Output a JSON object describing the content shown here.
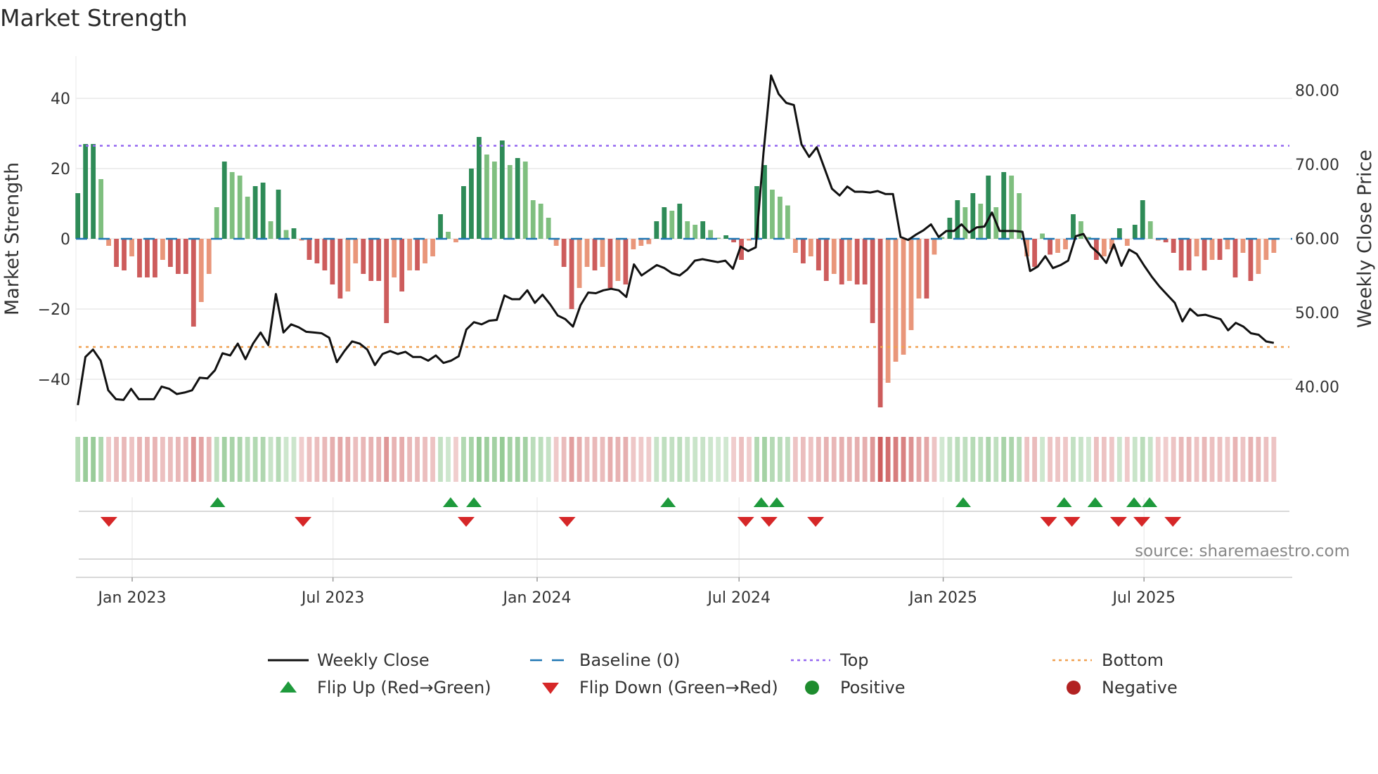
{
  "title": "Market Strength",
  "source": "source: sharemaestro.com",
  "colors": {
    "green_strong": "#2e8b57",
    "green_light": "#7fbf7f",
    "red_strong": "#cd5c5c",
    "red_light": "#e9967a",
    "line": "#111111",
    "baseline": "#1f77b4",
    "top": "#9467f0",
    "bottom": "#f0a050",
    "flip_up": "#1e9a3c",
    "flip_down": "#d62728"
  },
  "chart_data": {
    "type": "bar+line",
    "title": "Market Strength",
    "ylabel_left": "Market Strength",
    "ylabel_right": "Weekly Close Price",
    "ylim_left": [
      -52,
      52
    ],
    "ylim_right": [
      35.3,
      84.6
    ],
    "left_ticks": [
      "40",
      "20",
      "0",
      "−20",
      "−40"
    ],
    "left_tick_values": [
      40,
      20,
      0,
      -20,
      -40
    ],
    "right_ticks": [
      "80.00",
      "70.00",
      "60.00",
      "50.00",
      "40.00"
    ],
    "right_tick_values": [
      80,
      70,
      60,
      50,
      40
    ],
    "x_ticks": [
      "Jan 2023",
      "Jul 2023",
      "Jan 2024",
      "Jul 2024",
      "Jan 2025",
      "Jul 2025"
    ],
    "x_tick_dates": [
      "2023-01-01",
      "2023-07-01",
      "2024-01-01",
      "2024-07-01",
      "2025-01-01",
      "2025-07-01"
    ],
    "start_date": "2022-11-13",
    "end_date": "2025-10-26",
    "top_level": 26.5,
    "bottom_level": -30.8,
    "baseline": 0,
    "strength": [
      13,
      27,
      27,
      17,
      -2,
      -8,
      -9,
      -5,
      -11,
      -11,
      -11,
      -6,
      -8,
      -10,
      -10,
      -25,
      -18,
      -10,
      9,
      22,
      19,
      18,
      12,
      15,
      16,
      5,
      14,
      2.5,
      3,
      -0.5,
      -6,
      -7,
      -9,
      -13,
      -17,
      -15,
      -7,
      -10,
      -12,
      -12,
      -24,
      -11,
      -15,
      -9,
      -9,
      -7,
      -5,
      7,
      2,
      -1,
      15,
      20,
      29,
      24,
      22,
      28,
      21,
      23,
      22,
      11,
      10,
      6,
      -2,
      -8,
      -20,
      -14,
      -8,
      -9,
      -8,
      -14,
      -12,
      -13,
      -3,
      -2,
      -1.5,
      5,
      9,
      8,
      10,
      5,
      4,
      5,
      2.5,
      0.3,
      1,
      -1,
      -6,
      -0.5,
      15,
      21,
      14,
      12,
      9.5,
      -4,
      -7,
      -5,
      -9,
      -12,
      -10,
      -13,
      -12,
      -13,
      -13,
      -24,
      -48,
      -41,
      -35,
      -33,
      -26,
      -17,
      -17,
      -4.5,
      0.5,
      6,
      11,
      9,
      13,
      10,
      18,
      9,
      19,
      18,
      13,
      -5,
      -8,
      1.5,
      -4.5,
      -4,
      -3,
      7,
      5,
      0.5,
      -6,
      -5,
      -3,
      3,
      -2,
      4,
      11,
      5,
      -0.5,
      -1,
      -4,
      -9,
      -9,
      -5,
      -9,
      -6,
      -6,
      -3,
      -11,
      -4,
      -12,
      -10,
      -6,
      -4
    ],
    "weekly_close": [
      37.5,
      44,
      45,
      43.5,
      39.5,
      38.3,
      38.2,
      39.7,
      38.3,
      38.3,
      38.3,
      40,
      39.7,
      39,
      39.2,
      39.5,
      41.2,
      41.1,
      42.2,
      44.5,
      44.2,
      45.8,
      43.7,
      45.8,
      47.3,
      45.6,
      52.5,
      47.3,
      48.4,
      48,
      47.4,
      47.3,
      47.2,
      46.6,
      43.3,
      44.8,
      46.1,
      45.8,
      45,
      42.9,
      44.4,
      44.8,
      44.4,
      44.7,
      44,
      44,
      43.5,
      44.2,
      43.2,
      43.5,
      44.1,
      47.7,
      48.7,
      48.4,
      48.9,
      49,
      52.3,
      51.8,
      51.8,
      53,
      51.3,
      52.4,
      51.1,
      49.6,
      49.1,
      48.1,
      51,
      52.7,
      52.6,
      53,
      53.2,
      53,
      52.1,
      56.5,
      55,
      55.7,
      56.4,
      56,
      55.3,
      55,
      55.8,
      57,
      57.2,
      57,
      56.8,
      57,
      55.9,
      58.9,
      58.3,
      58.8,
      71.5,
      82,
      79.5,
      78.3,
      78,
      72.7,
      71,
      72.3,
      69.5,
      66.7,
      65.8,
      67,
      66.3,
      66.3,
      66.2,
      66.4,
      66,
      66,
      60.2,
      59.8,
      60.5,
      61.1,
      61.9,
      60.2,
      61,
      61,
      61.9,
      60.8,
      61.5,
      61.6,
      63.5,
      61,
      61,
      61,
      60.9,
      55.6,
      56.2,
      57.6,
      56,
      56.4,
      57,
      60.3,
      60.6,
      58.9,
      58,
      56.7,
      59.2,
      56.3,
      58.5,
      57.9,
      56.3,
      54.8,
      53.5,
      52.4,
      51.3,
      48.8,
      50.5,
      49.6,
      49.7,
      49.4,
      49.1,
      47.6,
      48.6,
      48.1,
      47.2,
      47,
      46.1,
      45.9
    ],
    "flip_up_dates": [
      "2023-03-19",
      "2023-10-15",
      "2023-11-05",
      "2024-04-28",
      "2024-07-21",
      "2024-08-04",
      "2025-01-19",
      "2025-04-20",
      "2025-05-18",
      "2025-06-22",
      "2025-07-06"
    ],
    "flip_down_dates": [
      "2022-12-11",
      "2023-06-04",
      "2023-10-29",
      "2024-01-28",
      "2024-07-07",
      "2024-07-28",
      "2024-09-08",
      "2025-04-06",
      "2025-04-27",
      "2025-06-08",
      "2025-06-29",
      "2025-07-27"
    ],
    "legend_placement": "bottom",
    "legend": [
      {
        "label": "Weekly Close",
        "kind": "line"
      },
      {
        "label": "Baseline (0)",
        "kind": "dash"
      },
      {
        "label": "Top",
        "kind": "dot-purple"
      },
      {
        "label": "Bottom",
        "kind": "dot-orange"
      },
      {
        "label": "Flip Up (Red→Green)",
        "kind": "tri-up"
      },
      {
        "label": "Flip Down (Green→Red)",
        "kind": "tri-down"
      },
      {
        "label": "Positive",
        "kind": "circle-green"
      },
      {
        "label": "Negative",
        "kind": "circle-red"
      }
    ]
  }
}
